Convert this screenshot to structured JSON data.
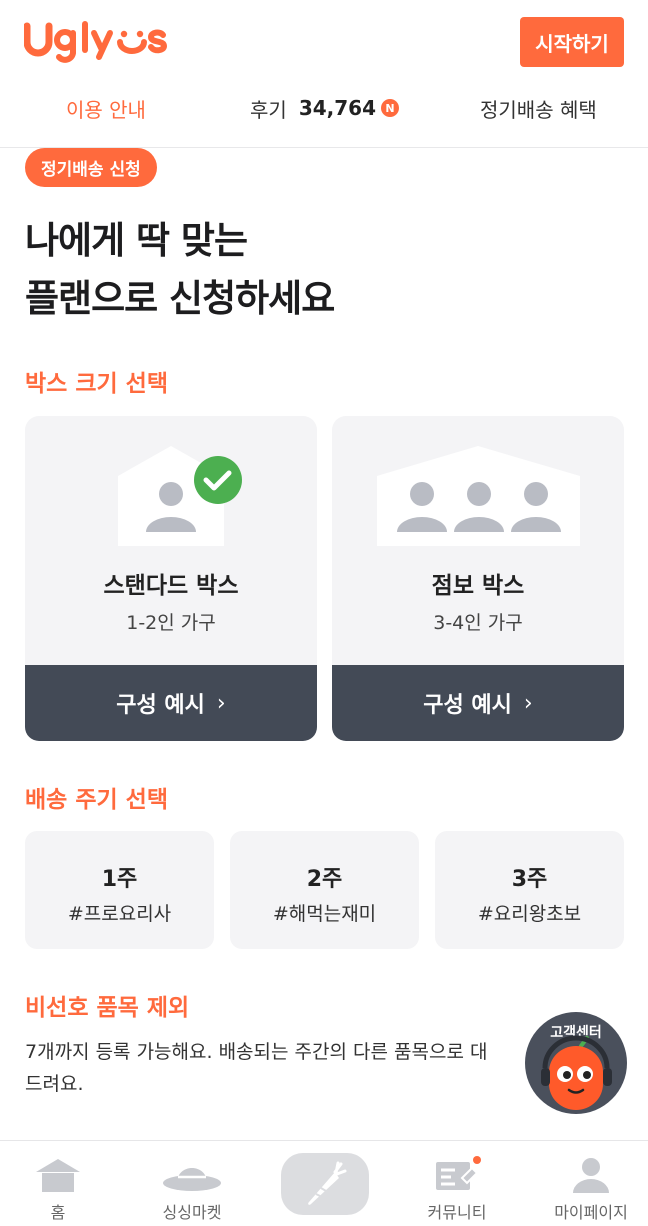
{
  "header": {
    "logo_text": "Ugly Us",
    "start_button": "시작하기",
    "tabs": [
      {
        "label": "이용 안내",
        "active": true
      },
      {
        "label": "후기",
        "count": "34,764",
        "badge": "N"
      },
      {
        "label": "정기배송 혜택"
      }
    ]
  },
  "main": {
    "pill": "정기배송 신청",
    "headline": [
      "나에게 딱 맞는",
      "플랜으로 신청하세요"
    ],
    "box_section_title": "박스 크기 선택",
    "boxes": [
      {
        "name": "스탠다드 박스",
        "sub": "1-2인 가구",
        "button": "구성 예시",
        "selected": true
      },
      {
        "name": "점보 박스",
        "sub": "3-4인 가구",
        "button": "구성 예시",
        "selected": false
      }
    ],
    "cycle_section_title": "배송 주기 선택",
    "cycles": [
      {
        "week": "1주",
        "tag": "#프로요리사"
      },
      {
        "week": "2주",
        "tag": "#해먹는재미"
      },
      {
        "week": "3주",
        "tag": "#요리왕초보"
      }
    ],
    "exclude_section_title": "비선호 품목 제외",
    "exclude_desc_line1": "7개까지 등록 가능해요. 배송되는 주간의 다른 품목으로 대",
    "exclude_desc_line2": "드려요."
  },
  "cs_button": {
    "label": "고객센터"
  },
  "bottom_nav": [
    {
      "label": "홈",
      "icon": "house-icon"
    },
    {
      "label": "싱싱마켓",
      "icon": "hat-icon"
    },
    {
      "label": "",
      "icon": "carrot-icon"
    },
    {
      "label": "커뮤니티",
      "icon": "community-icon"
    },
    {
      "label": "마이페이지",
      "icon": "person-icon"
    }
  ],
  "colors": {
    "accent": "#ff6a3d",
    "dark_button": "#434a56",
    "card_bg": "#f4f4f6",
    "check_green": "#4caf50"
  }
}
